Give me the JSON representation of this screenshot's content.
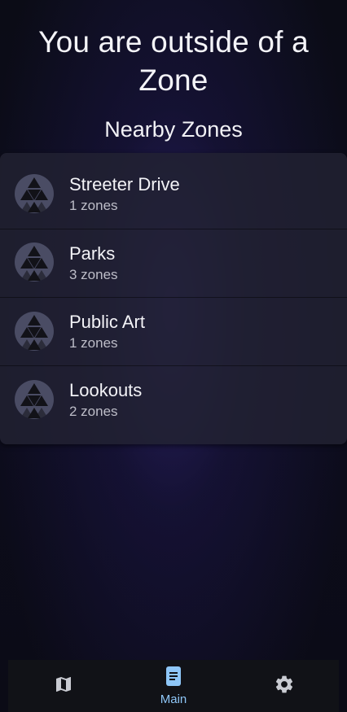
{
  "header": {
    "title": "You are outside of a Zone",
    "subtitle": "Nearby Zones"
  },
  "zones": [
    {
      "name": "Streeter Drive",
      "count": "1 zones",
      "icon": "zone-avatar-icon"
    },
    {
      "name": "Parks",
      "count": "3 zones",
      "icon": "zone-avatar-icon"
    },
    {
      "name": "Public Art",
      "count": "1 zones",
      "icon": "zone-avatar-icon"
    },
    {
      "name": "Lookouts",
      "count": "2 zones",
      "icon": "zone-avatar-icon"
    }
  ],
  "bottom_nav": {
    "items": [
      {
        "icon": "map-icon",
        "label": ""
      },
      {
        "icon": "document-icon",
        "label": "Main",
        "active": true
      },
      {
        "icon": "gear-icon",
        "label": ""
      }
    ]
  },
  "colors": {
    "accent": "#8ec6f7",
    "inactive_icon": "#c9cbd2",
    "card": "#222232",
    "background": "#0b0c16"
  }
}
